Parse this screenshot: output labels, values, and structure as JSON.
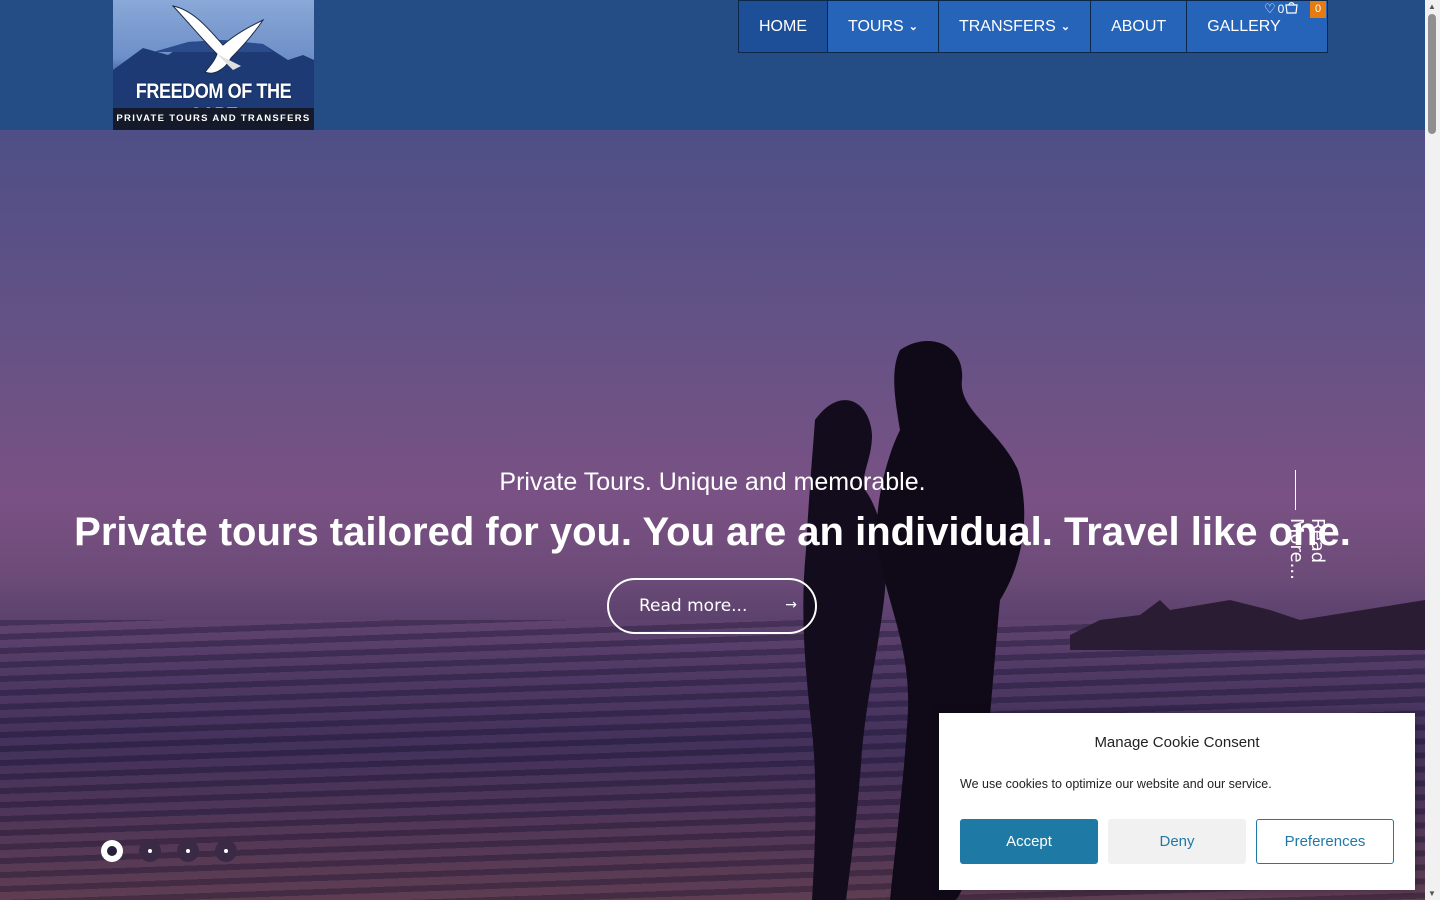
{
  "logo": {
    "brand": "FREEDOM OF THE CAPE",
    "tagline": "PRIVATE TOURS AND TRANSFERS"
  },
  "nav": {
    "items": [
      {
        "label": "HOME",
        "active": true
      },
      {
        "label": "TOURS",
        "dropdown": true
      },
      {
        "label": "TRANSFERS",
        "dropdown": true
      },
      {
        "label": "ABOUT"
      },
      {
        "label": "GALLERY"
      }
    ],
    "wishlist_count": "0",
    "cart_count": "0"
  },
  "hero": {
    "subtitle": "Private Tours. Unique and memorable.",
    "title": "Private tours tailored for you. You are an individual. Travel like one.",
    "button_label": "Read more...",
    "vertical_link": "Read More...",
    "slides_total": 4,
    "active_slide": 1
  },
  "cookie": {
    "title": "Manage Cookie Consent",
    "text": "We use cookies to optimize our website and our service.",
    "accept": "Accept",
    "deny": "Deny",
    "preferences": "Preferences"
  },
  "colors": {
    "header": "#234d84",
    "nav": "#2564b8",
    "accent": "#1f79a5",
    "badge": "#e67c11"
  }
}
